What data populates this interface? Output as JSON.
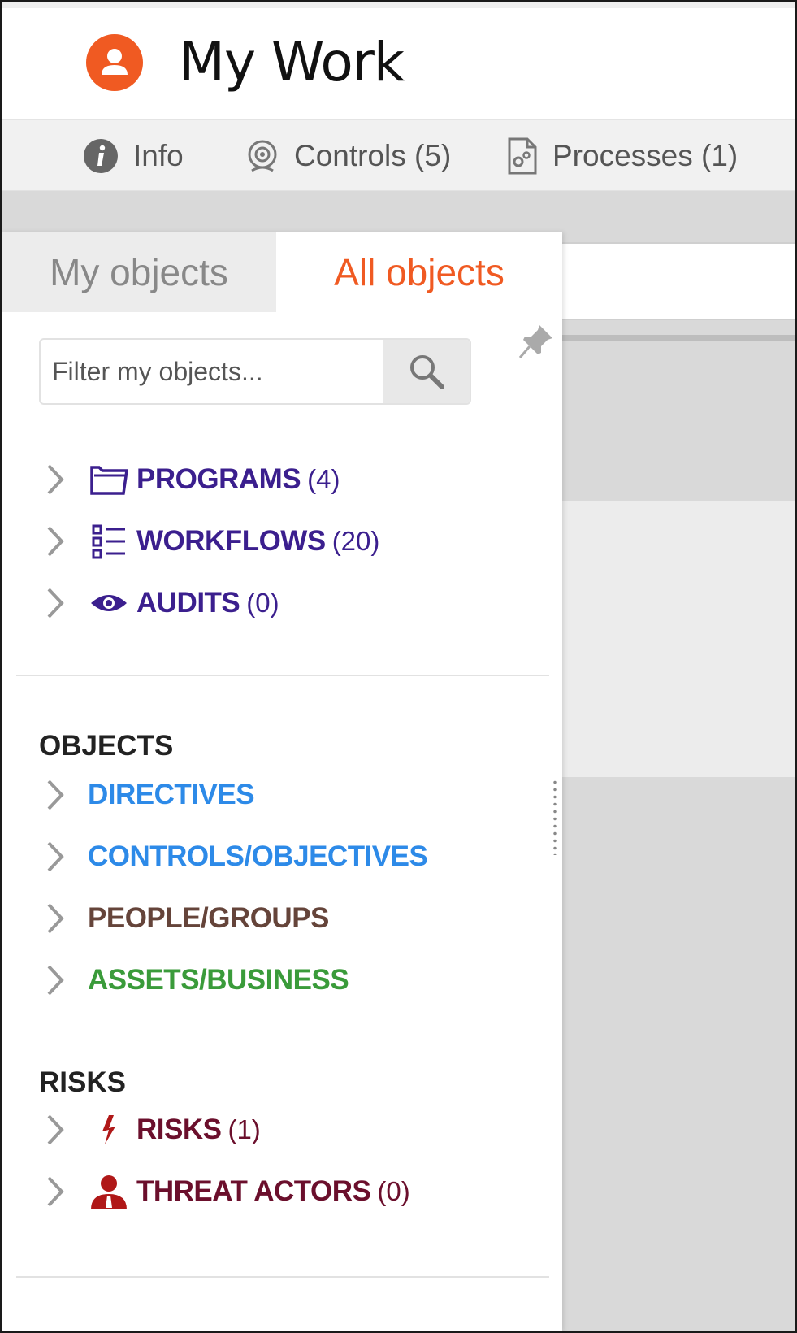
{
  "header": {
    "title": "My Work"
  },
  "tabs": [
    {
      "label": "Info",
      "icon": "info-icon"
    },
    {
      "label": "Controls (5)",
      "icon": "controls-icon"
    },
    {
      "label": "Processes (1)",
      "icon": "processes-icon"
    }
  ],
  "lhn": {
    "tabs": {
      "my": "My objects",
      "all": "All objects"
    },
    "filter": {
      "placeholder": "Filter my objects...",
      "value": ""
    },
    "top_items": [
      {
        "label": "PROGRAMS",
        "count": "(4)",
        "icon": "folder-icon"
      },
      {
        "label": "WORKFLOWS",
        "count": "(20)",
        "icon": "list-icon"
      },
      {
        "label": "AUDITS",
        "count": "(0)",
        "icon": "eye-icon"
      }
    ],
    "objects_heading": "OBJECTS",
    "objects": [
      {
        "label": "DIRECTIVES"
      },
      {
        "label": "CONTROLS/OBJECTIVES"
      },
      {
        "label": "PEOPLE/GROUPS"
      },
      {
        "label": "ASSETS/BUSINESS"
      }
    ],
    "risks_heading": "RISKS",
    "risks": [
      {
        "label": "RISKS",
        "count": "(1)",
        "icon": "lightning-icon"
      },
      {
        "label": "THREAT ACTORS",
        "count": "(0)",
        "icon": "threat-actor-icon"
      }
    ]
  },
  "colors": {
    "accent": "#f05a22",
    "program": "#3b1f8e",
    "directive": "#2d8ae8",
    "people": "#65443a",
    "assets": "#3a9b3a",
    "risk": "#6b0f2c"
  }
}
